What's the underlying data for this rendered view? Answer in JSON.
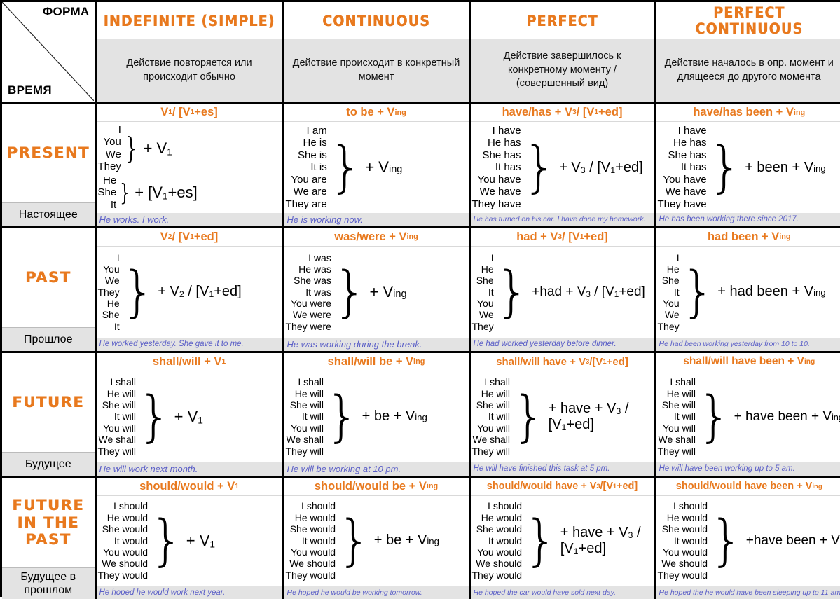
{
  "corner": {
    "form_label": "ФОРМА",
    "time_label": "ВРЕМЯ"
  },
  "colors": {
    "accent_orange": "#e8791e",
    "example_blue": "#5b5fc7",
    "shade_gray": "#e3e3e3"
  },
  "aspects": [
    {
      "title": "INDEFINITE (SIMPLE)",
      "description": "Действие повторяется или происходит обычно"
    },
    {
      "title": "CONTINUOUS",
      "description": "Действие происходит в конкретный момент"
    },
    {
      "title": "PERFECT",
      "description": "Действие завершилось к конкретному моменту / (совершенный вид)"
    },
    {
      "title": "PERFECT CONTINUOUS",
      "description": "Действие началось в опр. момент и длящееся до другого момента"
    }
  ],
  "tenses": [
    {
      "en": "PRESENT",
      "ru": "Настоящее"
    },
    {
      "en": "PAST",
      "ru": "Прошлое"
    },
    {
      "en": "FUTURE",
      "ru": "Будущее"
    },
    {
      "en": "FUTURE IN THE PAST",
      "ru": "Будущее в прошлом"
    }
  ],
  "cells": {
    "present_indefinite": {
      "formula": "V1 / [V1+es]",
      "group_a_pronouns": [
        "I",
        "You",
        "We",
        "They"
      ],
      "group_a_tail": "+ V1",
      "group_b_pronouns": [
        "He",
        "She",
        "It"
      ],
      "group_b_tail": "+ [V1+es]",
      "example": "He works. I work."
    },
    "present_continuous": {
      "formula": "to be + Ving",
      "pronouns": [
        "I am",
        "He is",
        "She is",
        "It is",
        "You are",
        "We are",
        "They are"
      ],
      "tail": "+ Ving",
      "example": "He is working now."
    },
    "present_perfect": {
      "formula": "have/has + V3 / [V1+ed]",
      "pronouns": [
        "I have",
        "He has",
        "She has",
        "It has",
        "You have",
        "We have",
        "They have"
      ],
      "tail": "+ V3 / [V1+ed]",
      "example": "He has turned on his car. I have done my homework."
    },
    "present_perfect_continuous": {
      "formula": "have/has been + Ving",
      "pronouns": [
        "I have",
        "He has",
        "She has",
        "It has",
        "You have",
        "We have",
        "They have"
      ],
      "tail": "+ been + Ving",
      "example": "He has been working there since 2017."
    },
    "past_indefinite": {
      "formula": "V2 / [V1+ed]",
      "pronouns": [
        "I",
        "You",
        "We",
        "They",
        "He",
        "She",
        "It"
      ],
      "tail": "+ V2 / [V1+ed]",
      "example": "He worked yesterday. She gave it to me."
    },
    "past_continuous": {
      "formula": "was/were + Ving",
      "pronouns": [
        "I was",
        "He was",
        "She was",
        "It was",
        "You were",
        "We were",
        "They were"
      ],
      "tail": "+ Ving",
      "example": "He was working during the break."
    },
    "past_perfect": {
      "formula": "had + V3 / [V1+ed]",
      "pronouns": [
        "I",
        "He",
        "She",
        "It",
        "You",
        "We",
        "They"
      ],
      "tail": "+had + V3 / [V1+ed]",
      "example": "He had worked yesterday before dinner."
    },
    "past_perfect_continuous": {
      "formula": "had been + Ving",
      "pronouns": [
        "I",
        "He",
        "She",
        "It",
        "You",
        "We",
        "They"
      ],
      "tail": "+ had been + Ving",
      "example": "He had been working yesterday from 10 to 10."
    },
    "future_indefinite": {
      "formula": "shall/will + V1",
      "pronouns": [
        "I shall",
        "He will",
        "She will",
        "It will",
        "You will",
        "We shall",
        "They will"
      ],
      "tail": "+ V1",
      "example": "He will work next month."
    },
    "future_continuous": {
      "formula": "shall/will be + Ving",
      "pronouns": [
        "I shall",
        "He will",
        "She will",
        "It will",
        "You will",
        "We shall",
        "They will"
      ],
      "tail": "+ be + Ving",
      "example": "He will be working at 10 pm."
    },
    "future_perfect": {
      "formula": "shall/will have + V3 / [V1+ed]",
      "pronouns": [
        "I shall",
        "He will",
        "She will",
        "It will",
        "You will",
        "We shall",
        "They will"
      ],
      "tail_line1": "+ have + V3 /",
      "tail_line2": "[V1+ed]",
      "example": "He will have finished this task at 5 pm."
    },
    "future_perfect_continuous": {
      "formula": "shall/will have been + Ving",
      "pronouns": [
        "I shall",
        "He will",
        "She will",
        "It will",
        "You will",
        "We shall",
        "They will"
      ],
      "tail": "+ have been + Ving",
      "example": "He will have been working up to 5 am."
    },
    "fip_indefinite": {
      "formula": "should/would + V1",
      "pronouns": [
        "I should",
        "He would",
        "She would",
        "It would",
        "You would",
        "We should",
        "They would"
      ],
      "tail": "+ V1",
      "example": "He hoped he would work next year."
    },
    "fip_continuous": {
      "formula": "should/would be + Ving",
      "pronouns": [
        "I should",
        "He would",
        "She would",
        "It would",
        "You would",
        "We should",
        "They would"
      ],
      "tail": "+ be + Ving",
      "example": "He hoped he would be working tomorrow."
    },
    "fip_perfect": {
      "formula": "should/would have + V3 / [V1+ed]",
      "pronouns": [
        "I should",
        "He would",
        "She would",
        "It would",
        "You would",
        "We should",
        "They would"
      ],
      "tail_line1": "+ have + V3 /",
      "tail_line2": "[V1+ed]",
      "example": "He hoped the car would have sold next day."
    },
    "fip_perfect_continuous": {
      "formula": "should/would have been + Ving",
      "pronouns": [
        "I should",
        "He would",
        "She would",
        "It would",
        "You would",
        "We should",
        "They would"
      ],
      "tail": "+ have been + Ving",
      "example": "He hoped the he would have been sleeping up to 11 am."
    }
  }
}
